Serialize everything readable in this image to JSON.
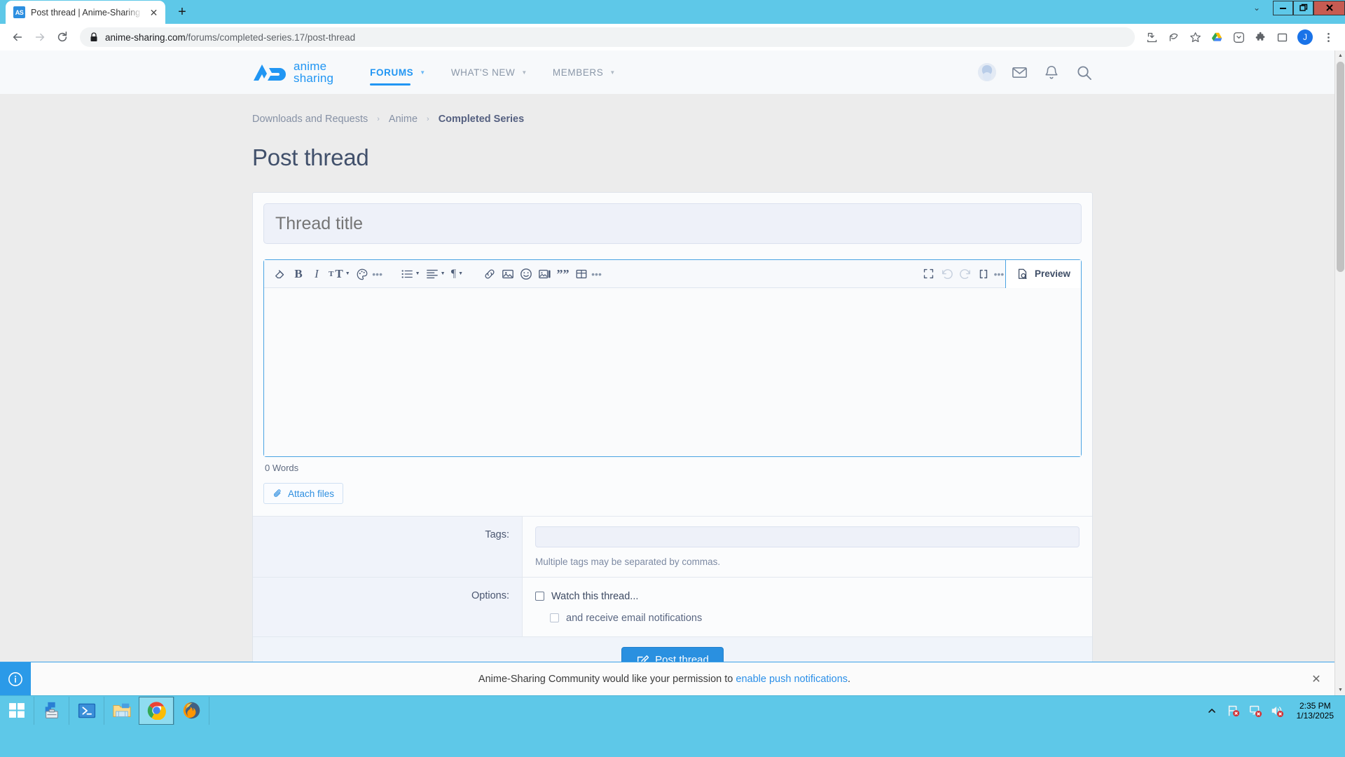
{
  "browser": {
    "tab": {
      "title": "Post thread | Anime-Sharing Com",
      "favicon_label": "AS",
      "close_icon": "close-icon"
    },
    "new_tab_label": "+",
    "window_controls": {
      "minimize": "—",
      "restore": "❐",
      "close": "✕",
      "chevron": "⌄"
    },
    "nav": {
      "back": "←",
      "forward": "→",
      "reload": "⟳"
    },
    "url": {
      "host": "anime-sharing.com",
      "path": "/forums/completed-series.17/post-thread",
      "lock_icon": "lock-icon"
    },
    "toolbar_icons": [
      "install-icon",
      "share-icon",
      "bookmark-star-icon",
      "google-drive-icon",
      "pocket-icon",
      "extensions-puzzle-icon",
      "side-panel-icon"
    ],
    "profile_initial": "J",
    "menu_icon": "three-dot-menu-icon"
  },
  "site": {
    "logo": {
      "mark": "AS",
      "line1": "anime",
      "line2": "sharing",
      "color": "#2196f3"
    },
    "nav": [
      {
        "label": "FORUMS",
        "active": true,
        "has_caret": true
      },
      {
        "label": "WHAT'S NEW",
        "active": false,
        "has_caret": true
      },
      {
        "label": "MEMBERS",
        "active": false,
        "has_caret": true
      }
    ],
    "header_icons": [
      "user-avatar",
      "inbox-envelope-icon",
      "alerts-bell-icon",
      "search-icon"
    ]
  },
  "breadcrumb": {
    "items": [
      "Downloads and Requests",
      "Anime"
    ],
    "current": "Completed Series",
    "separator": "›"
  },
  "page": {
    "title": "Post thread"
  },
  "form": {
    "thread_title_placeholder": "Thread title",
    "thread_title_value": "",
    "word_count": "0 Words",
    "attach_label": "Attach files",
    "preview_label": "Preview",
    "tags_label": "Tags:",
    "tags_value": "",
    "tags_hint": "Multiple tags may be separated by commas.",
    "options_label": "Options:",
    "option_watch": "Watch this thread...",
    "option_email": "and receive email notifications",
    "submit_label": "Post thread"
  },
  "editor_toolbar": {
    "left": [
      {
        "name": "remove-formatting-icon",
        "glyph": "eraser"
      },
      {
        "name": "bold-icon",
        "glyph": "B"
      },
      {
        "name": "italic-icon",
        "glyph": "I"
      },
      {
        "name": "font-size-icon",
        "glyph": "tT",
        "caret": true
      },
      {
        "name": "text-color-icon",
        "glyph": "palette"
      },
      {
        "name": "more-text-options-icon",
        "glyph": "dots"
      }
    ],
    "middle": [
      {
        "name": "bullet-list-icon",
        "glyph": "list",
        "caret": true
      },
      {
        "name": "text-align-icon",
        "glyph": "align",
        "caret": true
      },
      {
        "name": "paragraph-format-icon",
        "glyph": "¶",
        "caret": true
      }
    ],
    "insert": [
      {
        "name": "insert-link-icon",
        "glyph": "link"
      },
      {
        "name": "insert-image-icon",
        "glyph": "image"
      },
      {
        "name": "insert-smilie-icon",
        "glyph": "smilie"
      },
      {
        "name": "insert-media-icon",
        "glyph": "media"
      },
      {
        "name": "insert-quote-icon",
        "glyph": "quote"
      },
      {
        "name": "insert-table-icon",
        "glyph": "table"
      },
      {
        "name": "more-insert-options-icon",
        "glyph": "dots"
      }
    ],
    "right": [
      {
        "name": "fullscreen-icon",
        "glyph": "fullscreen",
        "disabled": false
      },
      {
        "name": "undo-icon",
        "glyph": "undo",
        "disabled": true
      },
      {
        "name": "redo-icon",
        "glyph": "redo",
        "disabled": true
      },
      {
        "name": "bb-code-icon",
        "glyph": "[ ]",
        "disabled": false
      },
      {
        "name": "more-editor-options-icon",
        "glyph": "dots",
        "disabled": false
      }
    ]
  },
  "notification": {
    "text_before": "Anime-Sharing Community would like your permission to ",
    "link": "enable push notifications",
    "text_after": ".",
    "info_icon": "info-icon",
    "close_icon": "close-icon"
  },
  "taskbar": {
    "start_icon": "windows-start-icon",
    "apps": [
      "server-manager-icon",
      "powershell-icon",
      "file-explorer-icon",
      "chrome-icon",
      "firefox-icon"
    ],
    "tray_icons": [
      "show-hidden-icons-chevron",
      "flag-action-center-icon",
      "network-icon",
      "volume-muted-icon"
    ],
    "time": "2:35 PM",
    "date": "1/13/2025"
  },
  "colors": {
    "browser_chrome": "#5ec8e8",
    "brand_blue": "#2196f3",
    "editor_border": "#4aa3e3",
    "page_bg": "#ececec",
    "button_blue": "#2a90e0"
  }
}
